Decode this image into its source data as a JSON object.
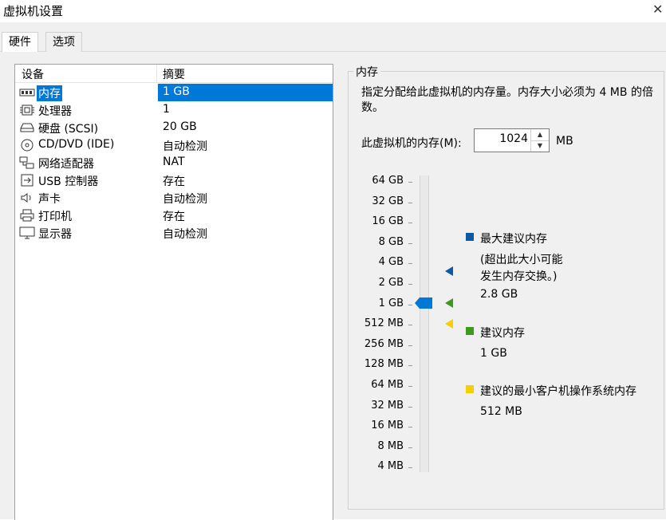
{
  "window": {
    "title": "虚拟机设置"
  },
  "tabs": [
    {
      "label": "硬件",
      "active": true
    },
    {
      "label": "选项",
      "active": false
    }
  ],
  "device_list": {
    "headers": {
      "device": "设备",
      "summary": "摘要"
    },
    "rows": [
      {
        "name": "内存",
        "summary": "1 GB",
        "icon": "memory-icon",
        "selected": true
      },
      {
        "name": "处理器",
        "summary": "1",
        "icon": "processor-icon"
      },
      {
        "name": "硬盘 (SCSI)",
        "summary": "20 GB",
        "icon": "harddisk-icon"
      },
      {
        "name": "CD/DVD (IDE)",
        "summary": "自动检测",
        "icon": "cd-dvd-icon"
      },
      {
        "name": "网络适配器",
        "summary": "NAT",
        "icon": "network-adapter-icon"
      },
      {
        "name": "USB 控制器",
        "summary": "存在",
        "icon": "usb-icon"
      },
      {
        "name": "声卡",
        "summary": "自动检测",
        "icon": "speaker-icon"
      },
      {
        "name": "打印机",
        "summary": "存在",
        "icon": "printer-icon"
      },
      {
        "name": "显示器",
        "summary": "自动检测",
        "icon": "monitor-icon"
      }
    ]
  },
  "memory_panel": {
    "group_title": "内存",
    "description": "指定分配给此虚拟机的内存量。内存大小必须为 4 MB 的倍数。",
    "field_label": "此虚拟机的内存(M):",
    "value": "1024",
    "unit": "MB",
    "scale_labels": [
      "64 GB",
      "32 GB",
      "16 GB",
      "8 GB",
      "4 GB",
      "2 GB",
      "1 GB",
      "512 MB",
      "256 MB",
      "128 MB",
      "64 MB",
      "32 MB",
      "16 MB",
      "8 MB",
      "4 MB"
    ],
    "selected_label": "1 GB",
    "legend": {
      "max": {
        "title": "最大建议内存",
        "note": "(超出此大小可能\n发生内存交换。)",
        "value": "2.8 GB",
        "color": "#0a5aa8"
      },
      "recommended": {
        "title": "建议内存",
        "value": "1 GB",
        "color": "#3c9a1e"
      },
      "min": {
        "title": "建议的最小客户机操作系统内存",
        "value": "512 MB",
        "color": "#f4d000"
      }
    }
  }
}
